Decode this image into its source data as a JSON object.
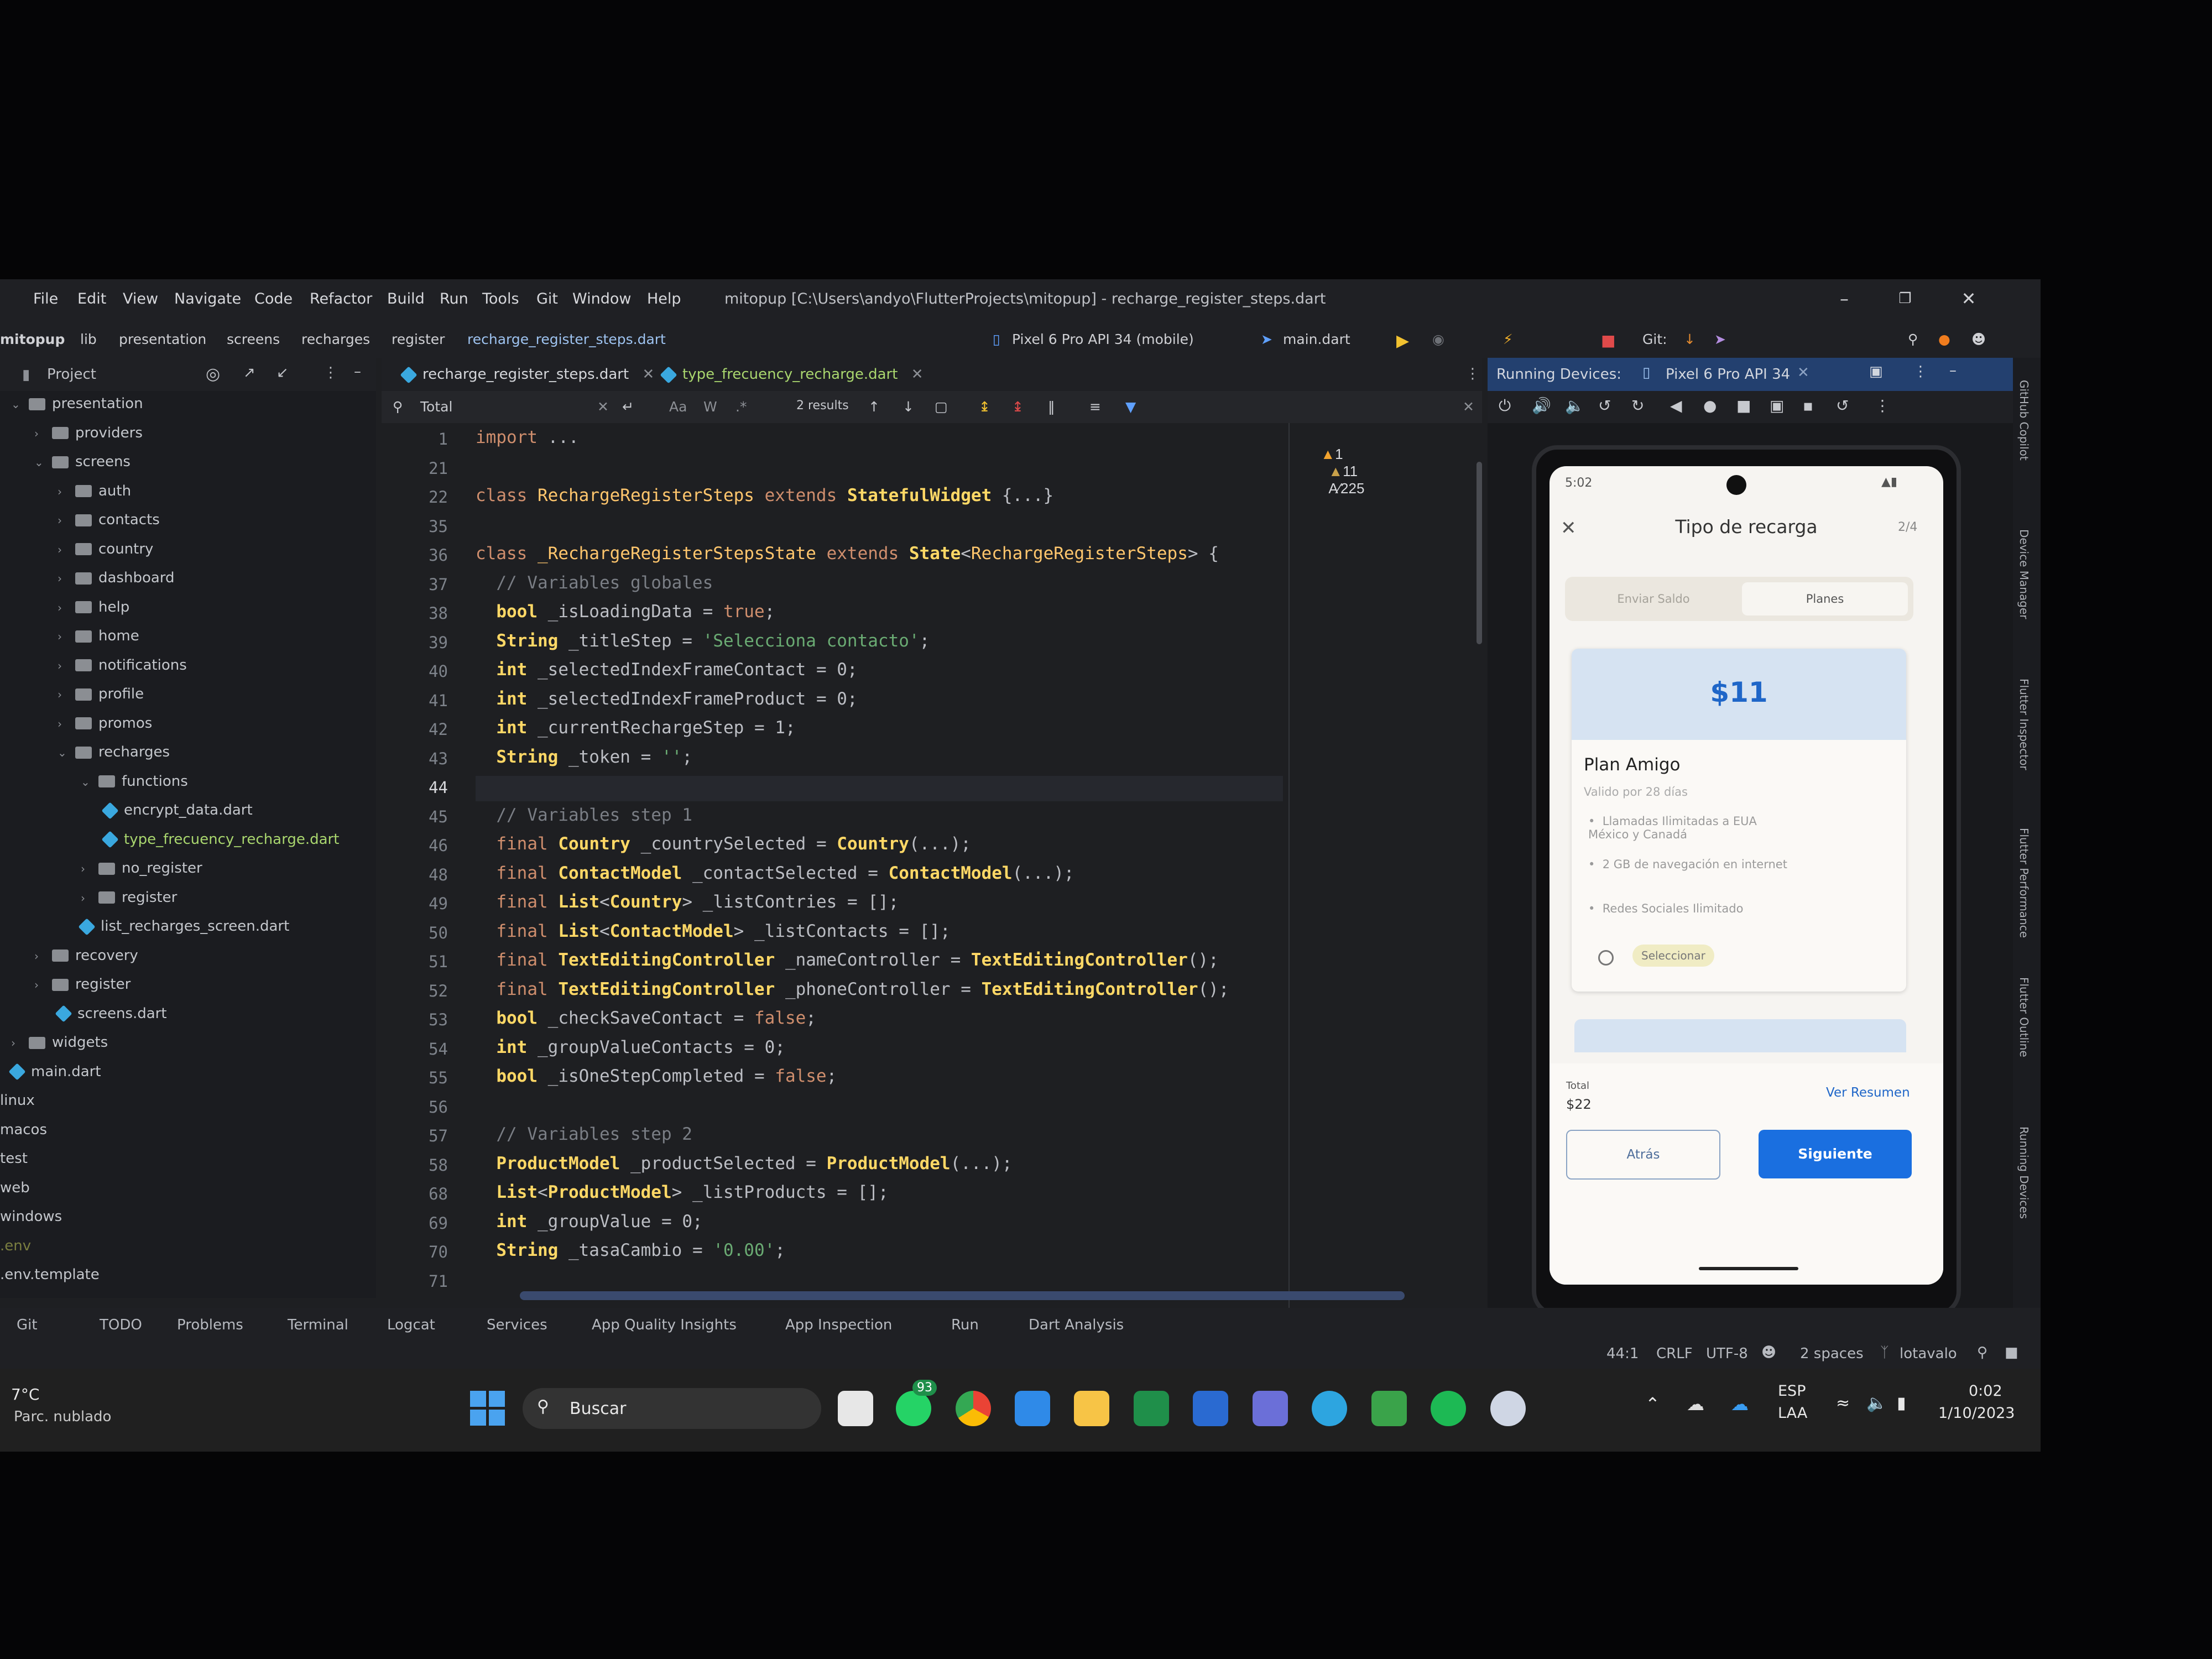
{
  "menu": {
    "items": [
      "File",
      "Edit",
      "View",
      "Navigate",
      "Code",
      "Refactor",
      "Build",
      "Run",
      "Tools",
      "Git",
      "Window",
      "Help"
    ],
    "title": "mitopup [C:\\Users\\andyo\\FlutterProjects\\mitopup] - recharge_register_steps.dart"
  },
  "toolbar": {
    "breadcrumb": [
      "mitopup",
      "lib",
      "presentation",
      "screens",
      "recharges",
      "register",
      "recharge_register_steps.dart"
    ],
    "device": "Pixel 6 Pro API 34 (mobile)",
    "run_config": "main.dart",
    "git_label": "Git:"
  },
  "project": {
    "header": "Project",
    "tree": [
      {
        "label": "presentation",
        "kind": "folder",
        "depth": 0,
        "open": true
      },
      {
        "label": "providers",
        "kind": "folder",
        "depth": 1
      },
      {
        "label": "screens",
        "kind": "folder",
        "depth": 1,
        "open": true
      },
      {
        "label": "auth",
        "kind": "folder",
        "depth": 2
      },
      {
        "label": "contacts",
        "kind": "folder",
        "depth": 2
      },
      {
        "label": "country",
        "kind": "folder",
        "depth": 2
      },
      {
        "label": "dashboard",
        "kind": "folder",
        "depth": 2
      },
      {
        "label": "help",
        "kind": "folder",
        "depth": 2
      },
      {
        "label": "home",
        "kind": "folder",
        "depth": 2
      },
      {
        "label": "notifications",
        "kind": "folder",
        "depth": 2
      },
      {
        "label": "profile",
        "kind": "folder",
        "depth": 2
      },
      {
        "label": "promos",
        "kind": "folder",
        "depth": 2
      },
      {
        "label": "recharges",
        "kind": "folder",
        "depth": 2,
        "open": true
      },
      {
        "label": "functions",
        "kind": "folder",
        "depth": 3,
        "open": true
      },
      {
        "label": "encrypt_data.dart",
        "kind": "dart",
        "depth": 4
      },
      {
        "label": "type_frecuency_recharge.dart",
        "kind": "dart",
        "depth": 4,
        "highlight": true
      },
      {
        "label": "no_register",
        "kind": "folder",
        "depth": 3
      },
      {
        "label": "register",
        "kind": "folder",
        "depth": 3
      },
      {
        "label": "list_recharges_screen.dart",
        "kind": "dart",
        "depth": 3
      },
      {
        "label": "recovery",
        "kind": "folder",
        "depth": 1
      },
      {
        "label": "register",
        "kind": "folder",
        "depth": 1
      },
      {
        "label": "screens.dart",
        "kind": "dart",
        "depth": 2
      },
      {
        "label": "widgets",
        "kind": "folder",
        "depth": 0
      },
      {
        "label": "main.dart",
        "kind": "dart",
        "depth": 0
      },
      {
        "label": "linux",
        "kind": "plain",
        "depth": -1
      },
      {
        "label": "macos",
        "kind": "plain",
        "depth": -1
      },
      {
        "label": "test",
        "kind": "plain",
        "depth": -1
      },
      {
        "label": "web",
        "kind": "plain",
        "depth": -1
      },
      {
        "label": "windows",
        "kind": "plain",
        "depth": -1
      },
      {
        "label": ".env",
        "kind": "plain",
        "depth": -1
      },
      {
        "label": ".env.template",
        "kind": "plain",
        "depth": -1
      }
    ]
  },
  "tabs": [
    {
      "label": "recharge_register_steps.dart",
      "active": true
    },
    {
      "label": "type_frecuency_recharge.dart",
      "active": false
    }
  ],
  "search": {
    "query": "Total",
    "results": "2 results",
    "case_label": "Aa",
    "word_label": "W",
    "regex_label": ".*"
  },
  "inspections": {
    "warnings": "1",
    "weak": "11",
    "typos": "225"
  },
  "code": [
    {
      "n": "1",
      "t": "import ..."
    },
    {
      "n": "21",
      "t": ""
    },
    {
      "n": "22",
      "t": "class RechargeRegisterSteps extends StatefulWidget {...}"
    },
    {
      "n": "35",
      "t": ""
    },
    {
      "n": "36",
      "t": "class _RechargeRegisterStepsState extends State<RechargeRegisterSteps> {"
    },
    {
      "n": "37",
      "t": "  // Variables globales"
    },
    {
      "n": "38",
      "t": "  bool _isLoadingData = true;"
    },
    {
      "n": "39",
      "t": "  String _titleStep = 'Selecciona contacto';"
    },
    {
      "n": "40",
      "t": "  int _selectedIndexFrameContact = 0;"
    },
    {
      "n": "41",
      "t": "  int _selectedIndexFrameProduct = 0;"
    },
    {
      "n": "42",
      "t": "  int _currentRechargeStep = 1;"
    },
    {
      "n": "43",
      "t": "  String _token = '';"
    },
    {
      "n": "44",
      "t": ""
    },
    {
      "n": "45",
      "t": "  // Variables step 1"
    },
    {
      "n": "46",
      "t": "  final Country _countrySelected = Country(...);"
    },
    {
      "n": "48",
      "t": "  final ContactModel _contactSelected = ContactModel(...);"
    },
    {
      "n": "49",
      "t": "  final List<Country> _listContries = [];"
    },
    {
      "n": "50",
      "t": "  final List<ContactModel> _listContacts = [];"
    },
    {
      "n": "51",
      "t": "  final TextEditingController _nameController = TextEditingController();"
    },
    {
      "n": "52",
      "t": "  final TextEditingController _phoneController = TextEditingController();"
    },
    {
      "n": "53",
      "t": "  bool _checkSaveContact = false;"
    },
    {
      "n": "54",
      "t": "  int _groupValueContacts = 0;"
    },
    {
      "n": "55",
      "t": "  bool _isOneStepCompleted = false;"
    },
    {
      "n": "56",
      "t": ""
    },
    {
      "n": "57",
      "t": "  // Variables step 2"
    },
    {
      "n": "58",
      "t": "  ProductModel _productSelected = ProductModel(...);"
    },
    {
      "n": "68",
      "t": "  List<ProductModel> _listProducts = [];"
    },
    {
      "n": "69",
      "t": "  int _groupValue = 0;"
    },
    {
      "n": "70",
      "t": "  String _tasaCambio = '0.00';"
    },
    {
      "n": "71",
      "t": ""
    }
  ],
  "devices": {
    "label": "Running Devices:",
    "tab": "Pixel 6 Pro API 34"
  },
  "phone": {
    "time": "5:02",
    "title": "Tipo de recarga",
    "step": "2/4",
    "segments": [
      "Enviar Saldo",
      "Planes"
    ],
    "price": "$11",
    "plan_name": "Plan Amigo",
    "validity": "Valido por 28 días",
    "features": [
      "Llamadas Ilimitadas a EUA México y Canadá",
      "2 GB de navegación en internet",
      "Redes Sociales Ilimitado"
    ],
    "select_label": "Seleccionar",
    "total_label": "Total",
    "total_value": "$22",
    "summary_link": "Ver Resumen",
    "back_button": "Atrás",
    "next_button": "Siguiente"
  },
  "right_tools": [
    "GitHub Copilot",
    "Device Manager",
    "Flutter Inspector",
    "Flutter Performance",
    "Flutter Outline",
    "Running Devices"
  ],
  "status_tools": [
    "Git",
    "TODO",
    "Problems",
    "Terminal",
    "Logcat",
    "Services",
    "App Quality Insights",
    "App Inspection",
    "Run",
    "Dart Analysis"
  ],
  "status_info": {
    "position": "44:1",
    "line_sep": "CRLF",
    "encoding": "UTF-8",
    "indent": "2 spaces",
    "branch": "lotavalo"
  },
  "taskbar": {
    "weather_temp": "7°C",
    "weather_desc": "Parc. nublado",
    "search_placeholder": "Buscar",
    "whatsapp_badge": "93",
    "lang_top": "ESP",
    "lang_bottom": "LAA",
    "time": "0:02",
    "date": "1/10/2023"
  },
  "colors": {
    "accent": "#3d7ee0",
    "device_header": "#23406f",
    "button_blue": "#1a6fe0",
    "price_band": "#d6e3f2"
  }
}
